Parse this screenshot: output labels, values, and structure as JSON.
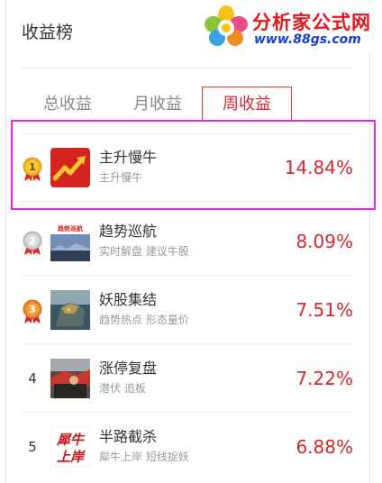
{
  "header": {
    "title": "收益榜"
  },
  "watermark": {
    "brand": "分析家公式网",
    "url": "www.88gs.com"
  },
  "tabs": [
    {
      "label": "总收益",
      "active": false
    },
    {
      "label": "月收益",
      "active": false
    },
    {
      "label": "周收益",
      "active": true
    }
  ],
  "colors": {
    "accent": "#d7282f",
    "highlight": "#e026e0"
  },
  "list": [
    {
      "rank": "1",
      "name": "主升慢牛",
      "desc": "主升慢牛",
      "pct": "14.84%",
      "medal": "gold"
    },
    {
      "rank": "2",
      "name": "趋势巡航",
      "desc": "实时解盘 建议牛股",
      "pct": "8.09%",
      "medal": "silver"
    },
    {
      "rank": "3",
      "name": "妖股集结",
      "desc": "趋势热点 形态量价",
      "pct": "7.51%",
      "medal": "bronze"
    },
    {
      "rank": "4",
      "name": "涨停复盘",
      "desc": "潜伏 追板",
      "pct": "7.22%",
      "medal": ""
    },
    {
      "rank": "5",
      "name": "半路截杀",
      "desc": "犀牛上岸 短线捉妖",
      "pct": "6.88%",
      "medal": ""
    }
  ],
  "thumb_text": {
    "row2": "趋势巡航",
    "row5_line1": "犀牛",
    "row5_line2": "上岸"
  }
}
